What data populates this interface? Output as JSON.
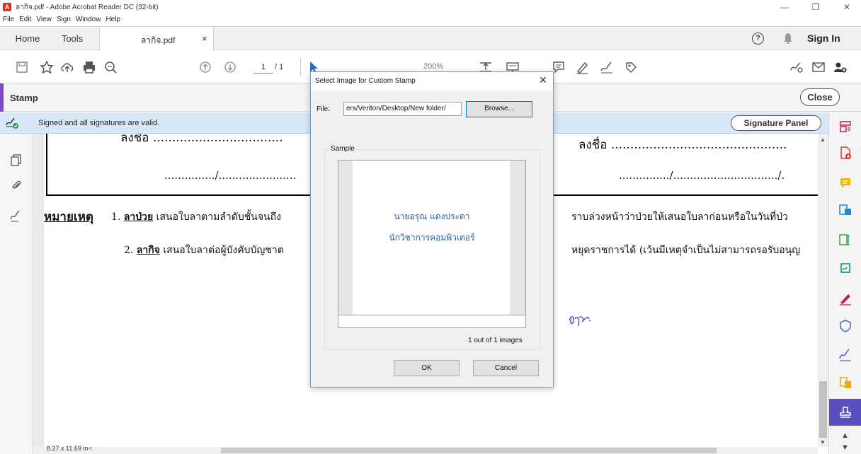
{
  "window": {
    "title": "ลากิจ.pdf - Adobe Acrobat Reader DC (32-bit)",
    "minimize": "—",
    "maximize": "❐",
    "close": "✕"
  },
  "menu": [
    "File",
    "Edit",
    "View",
    "Sign",
    "Window",
    "Help"
  ],
  "tabs": {
    "home": "Home",
    "tools": "Tools",
    "document": "ลากิจ.pdf",
    "close_glyph": "×",
    "sign_in": "Sign In"
  },
  "toolbar": {
    "current_page": "1",
    "page_count": "/ 1",
    "zoom": "200%"
  },
  "stamp_bar": {
    "label": "Stamp",
    "close": "Close"
  },
  "signature_bar": {
    "message": "Signed and all signatures are valid.",
    "panel_button": "Signature Panel"
  },
  "document": {
    "sign_left": "ลงชื่อ ..................................",
    "sign_right": "ลงชื่อ ..............................................",
    "date_left": ".............../.......................",
    "date_right": ".............../.............................../.",
    "remark": "หมายเหตุ",
    "item1_num": "1.",
    "item1_key": "ลาป่วย",
    "item1_text": " เสนอใบลาตามลำดับชั้นจนถึง",
    "item1_right": "ราบล่วงหน้าว่าป่วยให้เสนอใบลาก่อนหรือในวันที่ป่ว",
    "item2_num": "2.",
    "item2_key": "ลากิจ",
    "item2_text": " เสนอใบลาต่อผู้บังคับบัญชาต",
    "item2_right": "หยุดราชการได้ (เว้นมีเหตุจำเป็นไม่สามารถรอรับอนุญ",
    "page_size": "8.27 x 11.69 in"
  },
  "dialog": {
    "title": "Select Image for Custom Stamp",
    "close_glyph": "✕",
    "file_label": "File:",
    "file_value": "ers/Veriton/Desktop/New folder/",
    "browse": "Browse...",
    "sample_label": "Sample",
    "stamp_line1": "นายอรุณ  แดงประดา",
    "stamp_line2": "นักวิชาการคอมพิวเตอร์",
    "image_count": "1 out of 1 images",
    "ok": "OK",
    "cancel": "Cancel"
  },
  "colors": {
    "accent_purple": "#7c4dbf",
    "signature_bar": "#d7e7f7",
    "stamp_text": "#1e5fa8",
    "active_tool": "#5a4fbf"
  }
}
